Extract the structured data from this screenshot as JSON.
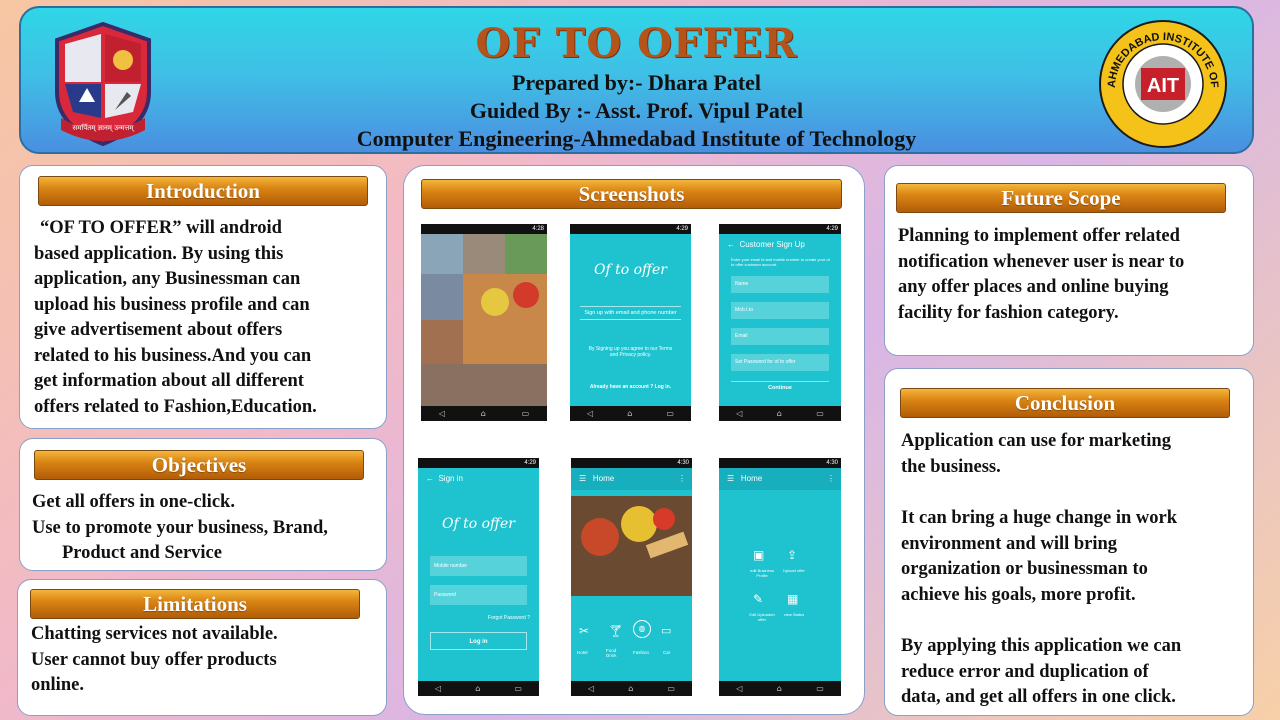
{
  "header": {
    "title": "OF TO OFFER",
    "prepared_by": "Prepared by:- Dhara Patel",
    "guided_by": "Guided By :- Asst. Prof. Vipul Patel",
    "department": "Computer Engineering-Ahmedabad Institute of Technology",
    "left_logo_text": "समर्पितम् ज्ञानम् उन्मत्तम्",
    "right_logo_text": "AHMEDABAD INSTITUTE OF TECHNOLOGY"
  },
  "introduction": {
    "heading": "Introduction",
    "lines": [
      "“OF TO OFFER” will android",
      "based application. By using this",
      "application, any Businessman can",
      "upload his business profile and can",
      "give advertisement about offers",
      "related to his business.And you can",
      "get information about all different",
      "offers related to Fashion,Education."
    ]
  },
  "objectives": {
    "heading": "Objectives",
    "lines": [
      "Get all offers in one-click.",
      "Use to promote your business, Brand,",
      "Product and Service"
    ]
  },
  "limitations": {
    "heading": "Limitations",
    "lines": [
      "Chatting services not available.",
      "User cannot buy offer products",
      "online."
    ]
  },
  "screenshots": {
    "heading": "Screenshots",
    "status_time_1": "4:28",
    "status_time_2": "4:29",
    "status_time_3": "4:30",
    "app_logo": "Of to offer",
    "signup_button": "Sign up with email and phone number",
    "terms": "By Signing up you agree to our Terms and Privacy policy.",
    "login_link": "Already have an account ? Log in.",
    "customer_signup_title": "Customer Sign Up",
    "customer_signup_hint": "Enter your email id and mobile number to create your of to offer customer account.",
    "fields": [
      "Name",
      "Mob.t.to",
      "Email",
      "Set Password for of to offer"
    ],
    "continue": "Continue",
    "signin_title": "Sign in",
    "signin_fields": [
      "Mobile number",
      "Password"
    ],
    "forgot": "Forgot Password ?",
    "login": "Log in",
    "home": "Home",
    "categories": [
      "Hotel",
      "Food Drink",
      "Fashion",
      "Car"
    ],
    "dashboard": [
      "edit Business Profile",
      "Upload offer",
      "Edit Uploaded offer",
      "view Status"
    ]
  },
  "future_scope": {
    "heading": "Future Scope",
    "lines": [
      "Planning to implement offer related",
      "notification whenever user is near to",
      "any offer places and online buying",
      "facility for fashion category."
    ]
  },
  "conclusion": {
    "heading": "Conclusion",
    "lines": [
      "Application can use for marketing",
      "the business.",
      "",
      "It can bring a huge change in work",
      "environment and will bring",
      "organization or businessman to",
      "achieve his goals, more profit.",
      "",
      "By applying this application we can",
      "reduce error and duplication of",
      "data, and get all offers in one click."
    ]
  }
}
